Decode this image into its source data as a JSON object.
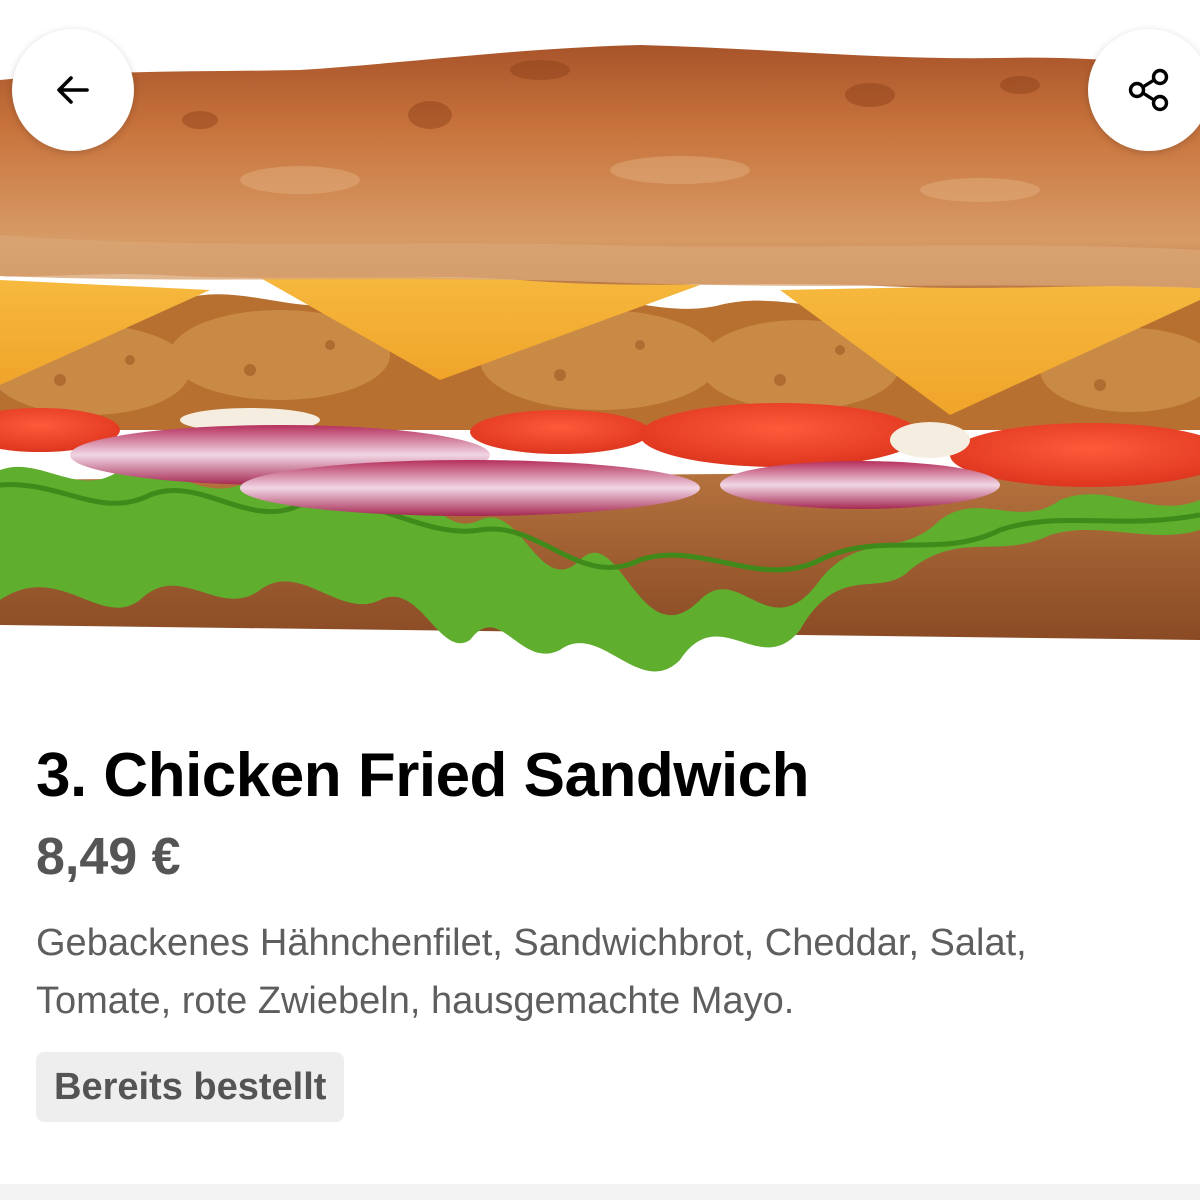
{
  "header": {
    "back_icon": "arrow-left-icon",
    "share_icon": "share-icon"
  },
  "hero_image": {
    "subject": "chicken-fried-sandwich-photo"
  },
  "product": {
    "title": "3. Chicken Fried Sandwich",
    "price": "8,49 €",
    "description": "Gebackenes Hähnchenfilet, Sandwichbrot, Cheddar, Salat, Tomate, rote Zwiebeln, hausgemachte Mayo.",
    "badge": "Bereits bestellt"
  },
  "colors": {
    "title": "#000000",
    "price": "#555555",
    "description": "#5e5e5e",
    "badge_bg": "#eeeeee",
    "badge_text": "#545454"
  }
}
